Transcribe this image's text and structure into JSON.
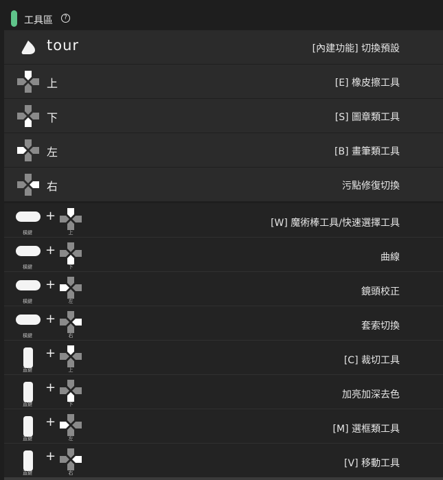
{
  "header": {
    "title": "工具區",
    "help_icon": "?"
  },
  "main_rows": [
    {
      "icon": "tour-logo-icon",
      "key": "tour",
      "desc": "[內建功能] 切換預設"
    },
    {
      "icon": "dpad-up-icon",
      "key": "上",
      "desc": "[E] 橡皮擦工具"
    },
    {
      "icon": "dpad-down-icon",
      "key": "下",
      "desc": "[S] 圖章類工具"
    },
    {
      "icon": "dpad-left-icon",
      "key": "左",
      "desc": "[B] 畫筆類工具"
    },
    {
      "icon": "dpad-right-icon",
      "key": "右",
      "desc": "污點修復切換"
    }
  ],
  "combo_rows": [
    {
      "btn": "horizontal",
      "btn_label": "橫鍵",
      "dir": "up",
      "dir_label": "上",
      "desc": "[W] 魔術棒工具/快速選擇工具"
    },
    {
      "btn": "horizontal",
      "btn_label": "橫鍵",
      "dir": "down",
      "dir_label": "下",
      "desc": "曲線"
    },
    {
      "btn": "horizontal",
      "btn_label": "橫鍵",
      "dir": "left",
      "dir_label": "左",
      "desc": "鏡頭校正"
    },
    {
      "btn": "horizontal",
      "btn_label": "橫鍵",
      "dir": "right",
      "dir_label": "右",
      "desc": "套索切換"
    },
    {
      "btn": "vertical",
      "btn_label": "直鍵",
      "dir": "up",
      "dir_label": "上",
      "desc": "[C] 裁切工具"
    },
    {
      "btn": "vertical",
      "btn_label": "直鍵",
      "dir": "down",
      "dir_label": "下",
      "desc": "加亮加深去色"
    },
    {
      "btn": "vertical",
      "btn_label": "直鍵",
      "dir": "left",
      "dir_label": "左",
      "desc": "[M] 選框類工具"
    },
    {
      "btn": "vertical",
      "btn_label": "直鍵",
      "dir": "right",
      "dir_label": "右",
      "desc": "[V] 移動工具"
    }
  ],
  "colors": {
    "accent": "#5fc48a",
    "dpad_gray": "#8a8a8a",
    "dpad_active": "#ffffff"
  }
}
